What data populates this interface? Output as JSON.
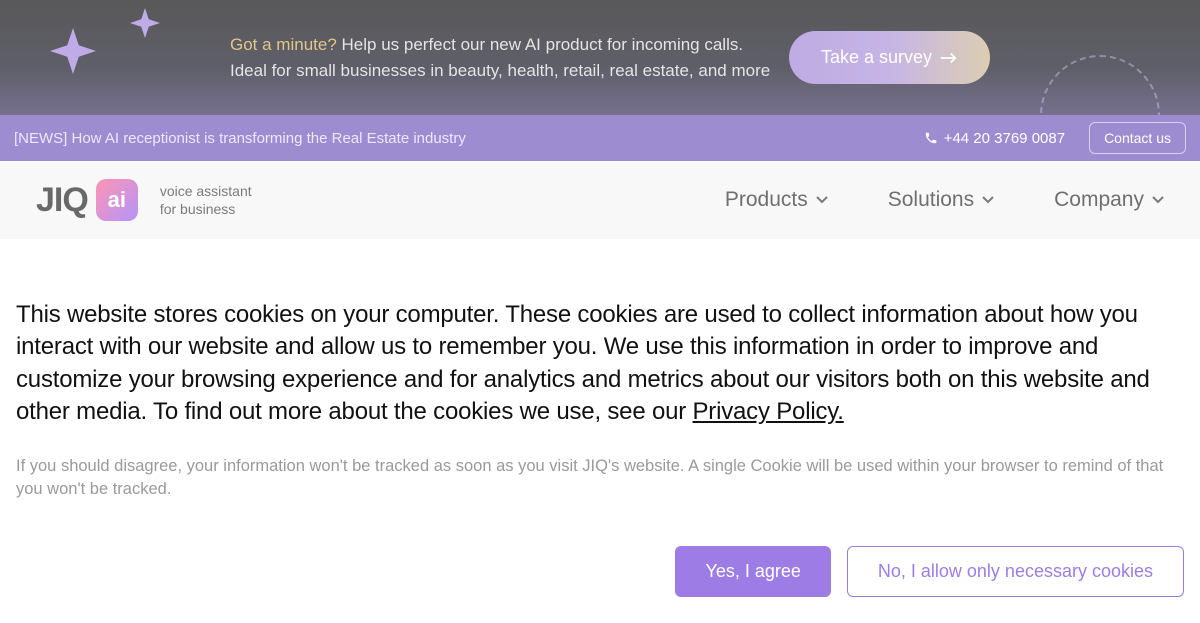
{
  "promo": {
    "highlight": "Got a minute?",
    "line1_rest": " Help us perfect our new AI product for incoming calls.",
    "line2": "Ideal for small businesses in beauty, health, retail, real estate, and more",
    "survey_label": "Take a survey"
  },
  "newsbar": {
    "text": "[NEWS] How AI receptionist is transforming the Real Estate industry",
    "phone": "+44 20 3769 0087",
    "contact_label": "Contact us"
  },
  "header": {
    "logo_text": "JIQ",
    "logo_badge": "ai",
    "sub_line1": "voice assistant",
    "sub_line2": "for business",
    "nav": {
      "products": "Products",
      "solutions": "Solutions",
      "company": "Company"
    }
  },
  "cookie": {
    "main_part1": "This website stores cookies on your computer. These cookies are used to collect information about how you interact with our website and allow us to remember you. We use this information in order to improve and customize your browsing experience and for analytics and metrics about our visitors both on this website and other media. To find out more about the cookies we use, see our ",
    "privacy_link": "Privacy Policy.",
    "sub": "If you should disagree, your information won't be tracked as soon as you visit JIQ's website. A single Cookie will be used within your browser to remind of that you won't be tracked.",
    "agree_label": "Yes, I agree",
    "decline_label": "No, I allow only necessary cookies"
  }
}
